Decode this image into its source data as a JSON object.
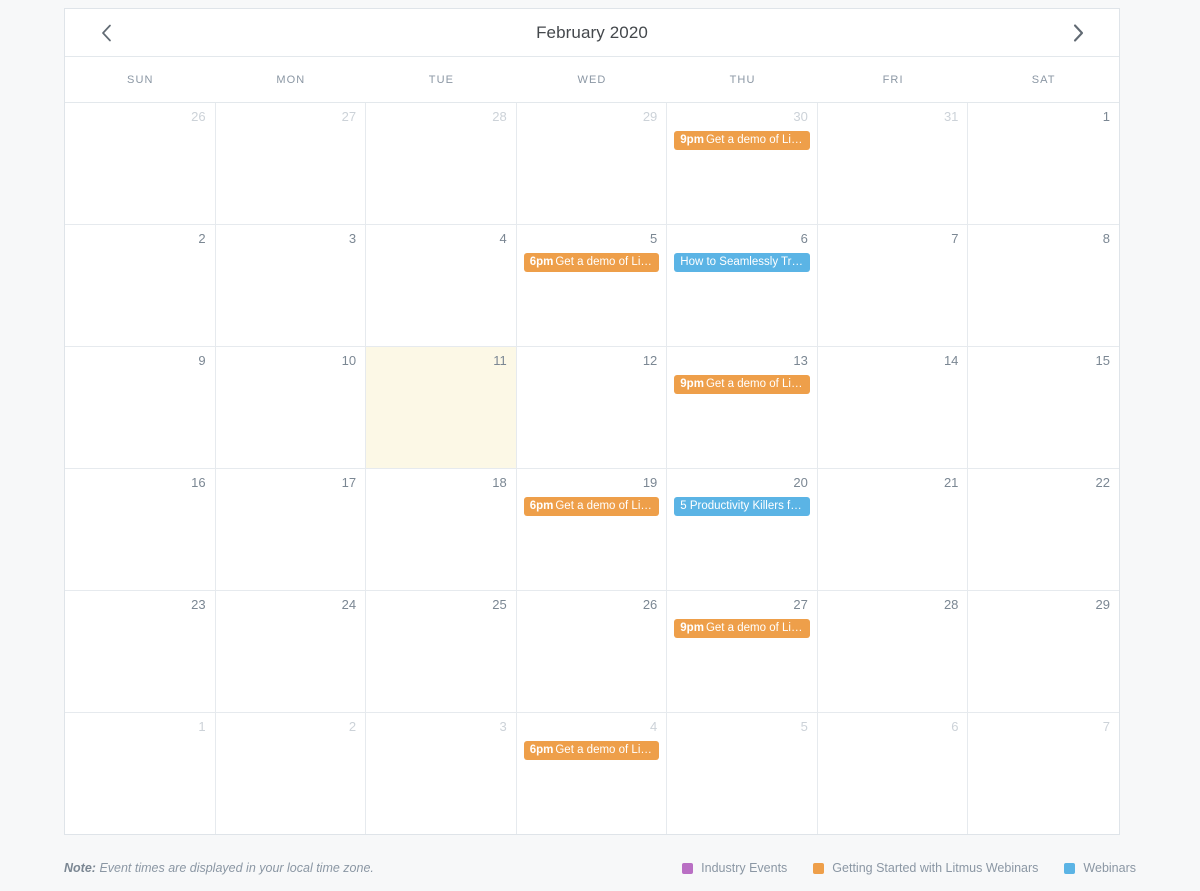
{
  "header": {
    "title": "February 2020",
    "prev_icon": "chevron-left-icon",
    "next_icon": "chevron-right-icon"
  },
  "weekdays": [
    "SUN",
    "MON",
    "TUE",
    "WED",
    "THU",
    "FRI",
    "SAT"
  ],
  "colors": {
    "orange": "#ee9f4a",
    "blue": "#5bb4e5",
    "purple": "#b96fc4",
    "today_bg": "#fcf8e6",
    "border": "#e6eaee",
    "page_bg": "#f7f8f9"
  },
  "weeks": [
    [
      {
        "num": "26",
        "other": true,
        "today": false,
        "events": []
      },
      {
        "num": "27",
        "other": true,
        "today": false,
        "events": []
      },
      {
        "num": "28",
        "other": true,
        "today": false,
        "events": []
      },
      {
        "num": "29",
        "other": true,
        "today": false,
        "events": []
      },
      {
        "num": "30",
        "other": true,
        "today": false,
        "events": [
          {
            "time": "9pm",
            "title": "Get a demo of Lit…",
            "color": "orange"
          }
        ]
      },
      {
        "num": "31",
        "other": true,
        "today": false,
        "events": []
      },
      {
        "num": "1",
        "other": false,
        "today": false,
        "events": []
      }
    ],
    [
      {
        "num": "2",
        "other": false,
        "today": false,
        "events": []
      },
      {
        "num": "3",
        "other": false,
        "today": false,
        "events": []
      },
      {
        "num": "4",
        "other": false,
        "today": false,
        "events": []
      },
      {
        "num": "5",
        "other": false,
        "today": false,
        "events": [
          {
            "time": "6pm",
            "title": "Get a demo of Lit…",
            "color": "orange"
          }
        ]
      },
      {
        "num": "6",
        "other": false,
        "today": false,
        "events": [
          {
            "time": "",
            "title": "How to Seamlessly Tra…",
            "color": "blue"
          }
        ]
      },
      {
        "num": "7",
        "other": false,
        "today": false,
        "events": []
      },
      {
        "num": "8",
        "other": false,
        "today": false,
        "events": []
      }
    ],
    [
      {
        "num": "9",
        "other": false,
        "today": false,
        "events": []
      },
      {
        "num": "10",
        "other": false,
        "today": false,
        "events": []
      },
      {
        "num": "11",
        "other": false,
        "today": true,
        "events": []
      },
      {
        "num": "12",
        "other": false,
        "today": false,
        "events": []
      },
      {
        "num": "13",
        "other": false,
        "today": false,
        "events": [
          {
            "time": "9pm",
            "title": "Get a demo of Lit…",
            "color": "orange"
          }
        ]
      },
      {
        "num": "14",
        "other": false,
        "today": false,
        "events": []
      },
      {
        "num": "15",
        "other": false,
        "today": false,
        "events": []
      }
    ],
    [
      {
        "num": "16",
        "other": false,
        "today": false,
        "events": []
      },
      {
        "num": "17",
        "other": false,
        "today": false,
        "events": []
      },
      {
        "num": "18",
        "other": false,
        "today": false,
        "events": []
      },
      {
        "num": "19",
        "other": false,
        "today": false,
        "events": [
          {
            "time": "6pm",
            "title": "Get a demo of Lit…",
            "color": "orange"
          }
        ]
      },
      {
        "num": "20",
        "other": false,
        "today": false,
        "events": [
          {
            "time": "",
            "title": "5 Productivity Killers fo…",
            "color": "blue"
          }
        ]
      },
      {
        "num": "21",
        "other": false,
        "today": false,
        "events": []
      },
      {
        "num": "22",
        "other": false,
        "today": false,
        "events": []
      }
    ],
    [
      {
        "num": "23",
        "other": false,
        "today": false,
        "events": []
      },
      {
        "num": "24",
        "other": false,
        "today": false,
        "events": []
      },
      {
        "num": "25",
        "other": false,
        "today": false,
        "events": []
      },
      {
        "num": "26",
        "other": false,
        "today": false,
        "events": []
      },
      {
        "num": "27",
        "other": false,
        "today": false,
        "events": [
          {
            "time": "9pm",
            "title": "Get a demo of Lit…",
            "color": "orange"
          }
        ]
      },
      {
        "num": "28",
        "other": false,
        "today": false,
        "events": []
      },
      {
        "num": "29",
        "other": false,
        "today": false,
        "events": []
      }
    ],
    [
      {
        "num": "1",
        "other": true,
        "today": false,
        "events": []
      },
      {
        "num": "2",
        "other": true,
        "today": false,
        "events": []
      },
      {
        "num": "3",
        "other": true,
        "today": false,
        "events": []
      },
      {
        "num": "4",
        "other": true,
        "today": false,
        "events": [
          {
            "time": "6pm",
            "title": "Get a demo of Lit…",
            "color": "orange"
          }
        ]
      },
      {
        "num": "5",
        "other": true,
        "today": false,
        "events": []
      },
      {
        "num": "6",
        "other": true,
        "today": false,
        "events": []
      },
      {
        "num": "7",
        "other": true,
        "today": false,
        "events": []
      }
    ]
  ],
  "footer": {
    "note_label": "Note:",
    "note_text": "Event times are displayed in your local time zone.",
    "legend": [
      {
        "label": "Industry Events",
        "color": "#b96fc4"
      },
      {
        "label": "Getting Started with Litmus Webinars",
        "color": "#ee9f4a"
      },
      {
        "label": "Webinars",
        "color": "#5bb4e5"
      }
    ]
  }
}
